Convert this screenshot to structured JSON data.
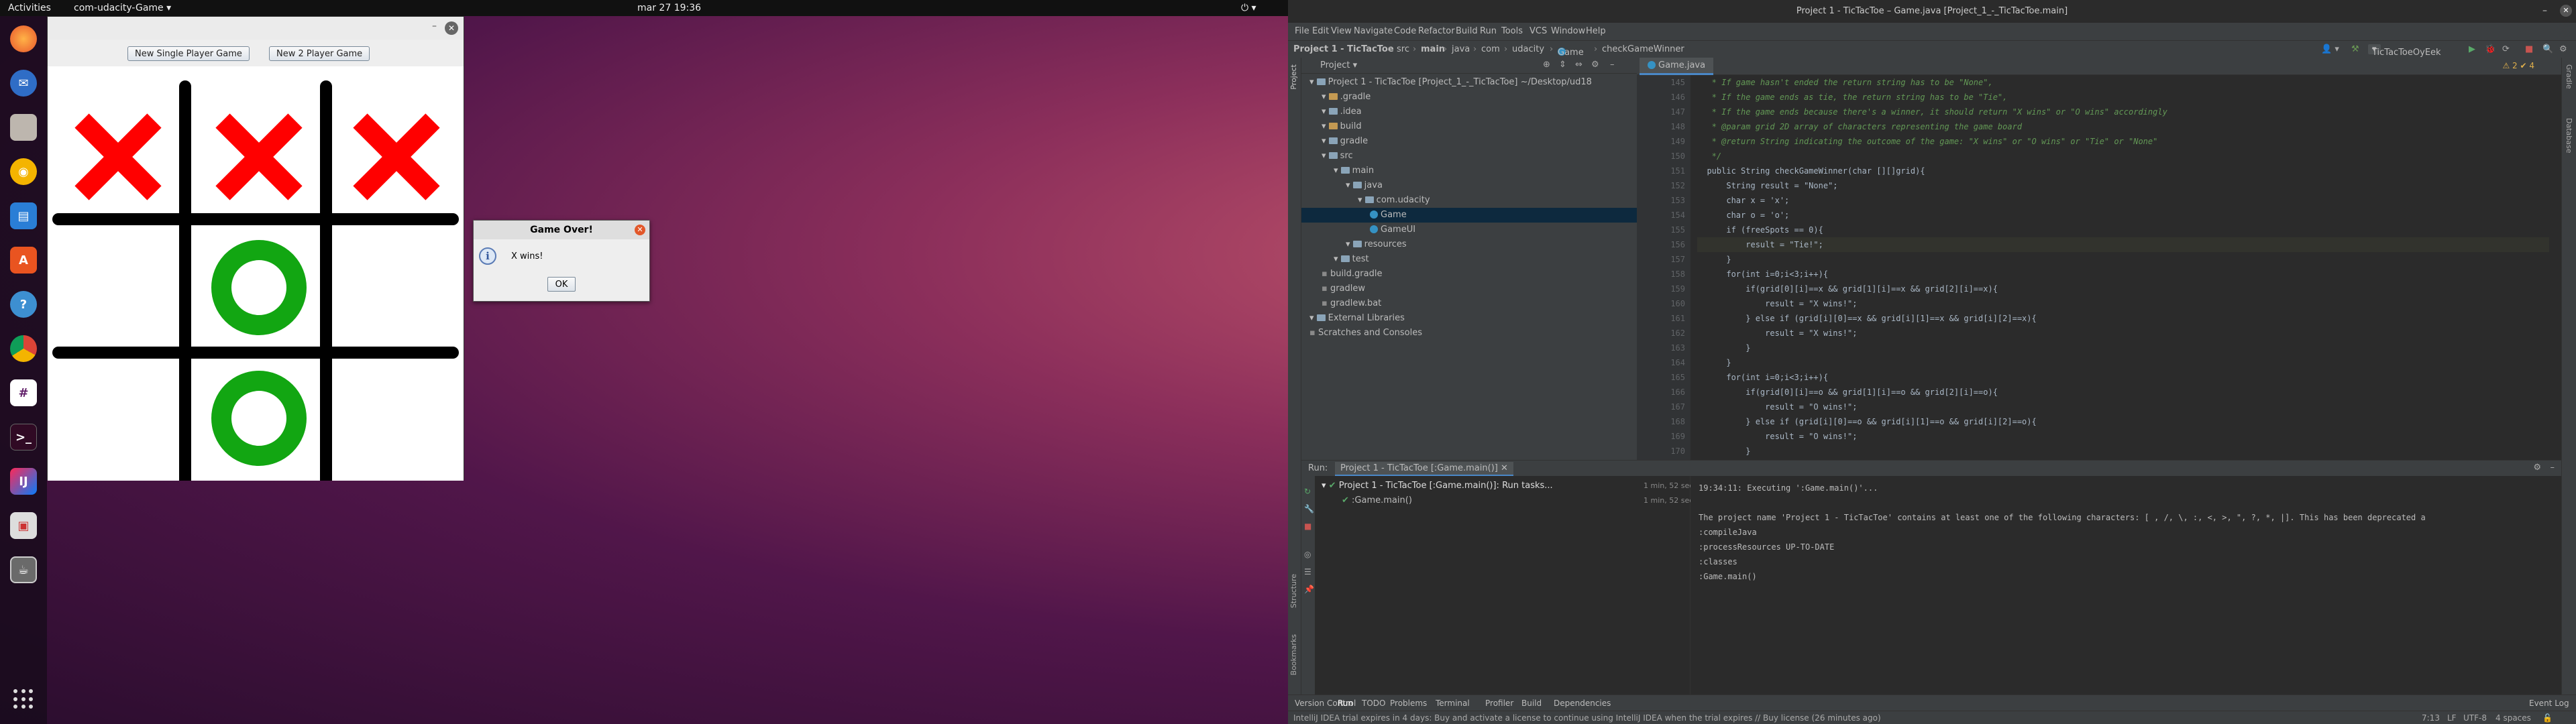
{
  "topbar": {
    "activities": "Activities",
    "app_name": "com-udacity-Game",
    "clock": "mar 27  19:36"
  },
  "dock": {
    "icons": [
      "firefox-icon",
      "thunderbird-icon",
      "files-icon",
      "rhythmbox-icon",
      "writer-icon",
      "software-icon",
      "help-icon",
      "chrome-icon",
      "slack-icon",
      "terminal-icon",
      "intellij-icon",
      "screenshot-icon",
      "game-icon",
      "show-apps-icon"
    ]
  },
  "game": {
    "btn_single": "New Single Player Game",
    "btn_two": "New 2 Player Game",
    "cells": [
      "X",
      "X",
      "X",
      "",
      "O",
      "",
      "",
      "O",
      ""
    ],
    "x_color": "#ff0000",
    "o_color": "#12a612"
  },
  "dialog": {
    "title": "Game Over!",
    "message": "X wins!",
    "ok": "OK"
  },
  "ide": {
    "title": "Project 1 - TicTacToe – Game.java [Project_1_-_TicTacToe.main]",
    "menu": [
      "File",
      "Edit",
      "View",
      "Navigate",
      "Code",
      "Refactor",
      "Build",
      "Run",
      "Tools",
      "VCS",
      "Window",
      "Help"
    ],
    "breadcrumb": [
      "Project 1 - TicTacToe",
      "src",
      "main",
      "java",
      "com",
      "udacity",
      "Game",
      "checkGameWinner"
    ],
    "run_config": "TicTacToeOyEek",
    "project_label": "Project",
    "tree": [
      {
        "label": "Project 1 - TicTacToe [Project_1_-_TicTacToe]  ~/Desktop/ud18",
        "indent": 0,
        "type": "folder"
      },
      {
        "label": ".gradle",
        "indent": 1,
        "type": "orange"
      },
      {
        "label": ".idea",
        "indent": 1,
        "type": "folder"
      },
      {
        "label": "build",
        "indent": 1,
        "type": "orange"
      },
      {
        "label": "gradle",
        "indent": 1,
        "type": "folder"
      },
      {
        "label": "src",
        "indent": 1,
        "type": "folder"
      },
      {
        "label": "main",
        "indent": 2,
        "type": "folder"
      },
      {
        "label": "java",
        "indent": 3,
        "type": "folder"
      },
      {
        "label": "com.udacity",
        "indent": 4,
        "type": "folder"
      },
      {
        "label": "Game",
        "indent": 5,
        "type": "java"
      },
      {
        "label": "GameUI",
        "indent": 5,
        "type": "java"
      },
      {
        "label": "resources",
        "indent": 3,
        "type": "folder"
      },
      {
        "label": "test",
        "indent": 2,
        "type": "folder"
      },
      {
        "label": "build.gradle",
        "indent": 1,
        "type": "file"
      },
      {
        "label": "gradlew",
        "indent": 1,
        "type": "file"
      },
      {
        "label": "gradlew.bat",
        "indent": 1,
        "type": "file"
      },
      {
        "label": "External Libraries",
        "indent": 0,
        "type": "folder"
      },
      {
        "label": "Scratches and Consoles",
        "indent": 0,
        "type": "file"
      }
    ],
    "editor_tab": "Game.java",
    "warnings": "⚠ 2  ✔ 4",
    "line_numbers": [
      "145",
      "146",
      "147",
      "148",
      "149",
      "150",
      "151",
      "152",
      "153",
      "154",
      "155",
      "156",
      "157",
      "158",
      "159",
      "160",
      "161",
      "162",
      "163",
      "164",
      "165",
      "166",
      "167",
      "168",
      "169",
      "170",
      "171"
    ],
    "code_lines": [
      "   * If game hasn't ended the return string has to be \"None\",",
      "   * If the game ends as tie, the return string has to be \"Tie\",",
      "   * If the game ends because there's a winner, it should return \"X wins\" or \"O wins\" accordingly",
      "   * @param grid 2D array of characters representing the game board",
      "   * @return String indicating the outcome of the game: \"X wins\" or \"O wins\" or \"Tie\" or \"None\"",
      "   */",
      "  public String checkGameWinner(char [][]grid){",
      "      String result = \"None\";",
      "      char x = 'x';",
      "      char o = 'o';",
      "      if (freeSpots == 0){",
      "          result = \"Tie!\";",
      "      }",
      "      for(int i=0;i<3;i++){",
      "          if(grid[0][i]==x && grid[1][i]==x && grid[2][i]==x){",
      "              result = \"X wins!\";",
      "          } else if (grid[i][0]==x && grid[i][1]==x && grid[i][2]==x){",
      "              result = \"X wins!\";",
      "          }",
      "      }",
      "      for(int i=0;i<3;i++){",
      "          if(grid[0][i]==o && grid[1][i]==o && grid[2][i]==o){",
      "              result = \"O wins!\";",
      "          } else if (grid[i][0]==o && grid[i][1]==o && grid[i][2]==o){",
      "              result = \"O wins!\";",
      "          }",
      "      }"
    ],
    "run_label": "Run:",
    "run_tab": "Project 1 - TicTacToe [:Game.main()]",
    "run_tree": [
      "Project 1 - TicTacToe [:Game.main()]: Run tasks...",
      ":Game.main()"
    ],
    "run_times": [
      "1 min, 52 sec",
      "1 min, 52 sec"
    ],
    "console": [
      "19:34:11: Executing ':Game.main()'...",
      "",
      "The project name 'Project 1 - TicTacToe' contains at least one of the following characters: [ , /, \\, :, <, >, \", ?, *, |]. This has been deprecated a",
      ":compileJava",
      ":processResources UP-TO-DATE",
      ":classes",
      ":Game.main()"
    ],
    "bottom_tabs": [
      "Version Control",
      "Run",
      "TODO",
      "Problems",
      "Terminal",
      "Profiler",
      "Build",
      "Dependencies"
    ],
    "event_log": "Event Log",
    "status_msg": "IntelliJ IDEA trial expires in 4 days: Buy and activate a license to continue using IntelliJ IDEA when the trial expires // Buy license (26 minutes ago)",
    "status_right": [
      "7:13",
      "LF",
      "UTF-8",
      "4 spaces"
    ]
  }
}
